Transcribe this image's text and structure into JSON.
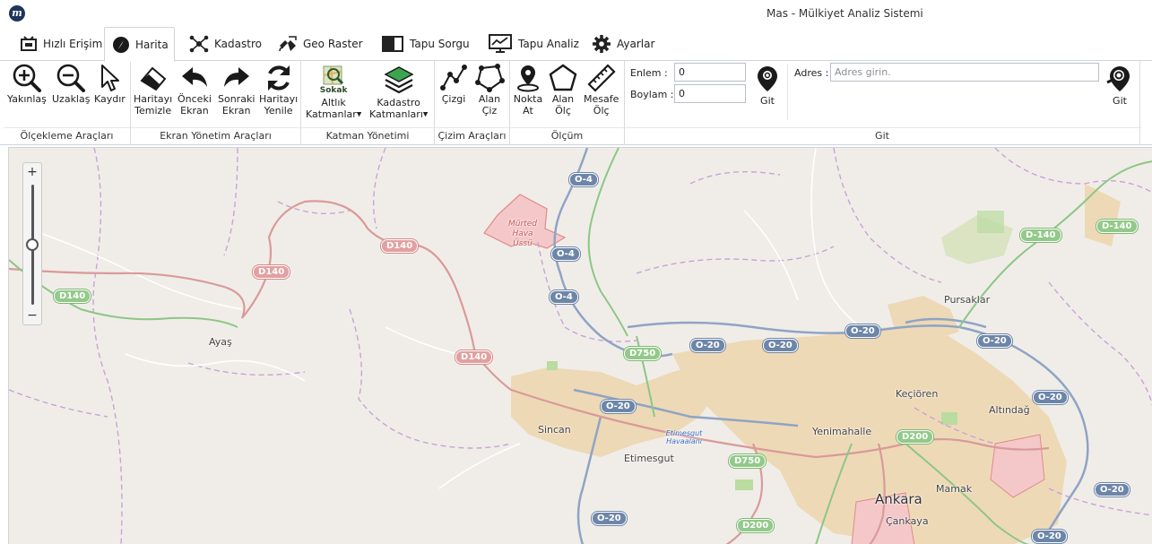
{
  "window": {
    "title": "Mas - Mülkiyet Analiz Sistemi",
    "logo_letter": "m"
  },
  "tabs": [
    {
      "label": "Hızlı Erişim",
      "icon": "quick-access-icon",
      "active": false
    },
    {
      "label": "Harita",
      "icon": "compass-icon",
      "active": true
    },
    {
      "label": "Kadastro",
      "icon": "network-icon",
      "active": false
    },
    {
      "label": "Geo Raster",
      "icon": "satellite-icon",
      "active": false
    },
    {
      "label": "Tapu Sorgu",
      "icon": "book-icon",
      "active": false
    },
    {
      "label": "Tapu Analiz",
      "icon": "monitor-chart-icon",
      "active": false
    },
    {
      "label": "Ayarlar",
      "icon": "gear-icon",
      "active": false
    }
  ],
  "ribbon": {
    "scale": {
      "label": "Ölçekleme Araçları",
      "zoom_in": "Yakınlaş",
      "zoom_out": "Uzaklaş",
      "pan": "Kaydır"
    },
    "screen": {
      "label": "Ekran Yönetim Araçları",
      "clear_1": "Haritayı",
      "clear_2": "Temizle",
      "prev_1": "Önceki",
      "prev_2": "Ekran",
      "next_1": "Sonraki",
      "next_2": "Ekran",
      "refresh_1": "Haritayı",
      "refresh_2": "Yenile"
    },
    "layers": {
      "label": "Katman Yönetimi",
      "base_badge": "Sokak",
      "base_1": "Altlık",
      "base_2": "Katmanlar",
      "cad_1": "Kadastro",
      "cad_2": "Katmanları"
    },
    "draw": {
      "label": "Çizim Araçları",
      "line": "Çizgi",
      "area_1": "Alan",
      "area_2": "Çiz"
    },
    "measure": {
      "label": "Ölçüm",
      "point_1": "Nokta",
      "point_2": "At",
      "area_1": "Alan",
      "area_2": "Ölç",
      "dist_1": "Mesafe",
      "dist_2": "Ölç"
    },
    "goto": {
      "label": "Git",
      "lat_label": "Enlem :",
      "lat_value": "0",
      "lon_label": "Boylam :",
      "lon_value": "0",
      "go_coord": "Git",
      "address_label": "Adres :",
      "address_placeholder": "Adres girin.",
      "go_address": "Git"
    }
  },
  "map": {
    "zoom_in": "+",
    "zoom_out": "−",
    "zoom_level_fraction": 0.5,
    "roads": {
      "o4_a": "O-4",
      "o4_b": "O-4",
      "o4_c": "O-4",
      "d140_a": "D140",
      "d140_b": "D140",
      "d140_c": "D140",
      "d140_d": "D140",
      "d140_e": "D-140",
      "d140_f": "D-140",
      "o20_a": "O-20",
      "o20_b": "O-20",
      "o20_c": "O-20",
      "o20_d": "O-20",
      "o20_e": "O-20",
      "o20_f": "O-20",
      "o20_g": "O-20",
      "o20_h": "O-20",
      "o20_i": "O-20",
      "d750_a": "D750",
      "d750_b": "D750",
      "d200_a": "D200",
      "d200_b": "D200"
    },
    "places": {
      "murted": "Mürted Hava Üssü",
      "ayas": "Ayaş",
      "pursaklar": "Pursaklar",
      "kecioren": "Keçiören",
      "sincan": "Sincan",
      "etimesgut": "Etimesgut",
      "etimesgut_airport": "Etimesgut Havaalanı",
      "yenimahalle": "Yenimahalle",
      "altindag": "Altındağ",
      "ankara": "Ankara",
      "mamak": "Mamak",
      "cankaya": "Çankaya"
    },
    "colors": {
      "background": "#f0ede8",
      "urban": "#eed7b0",
      "motorway": "#8fa4c4",
      "trunk": "#d99a9a",
      "primary": "#8cc784",
      "boundary": "#c79ad6"
    }
  }
}
